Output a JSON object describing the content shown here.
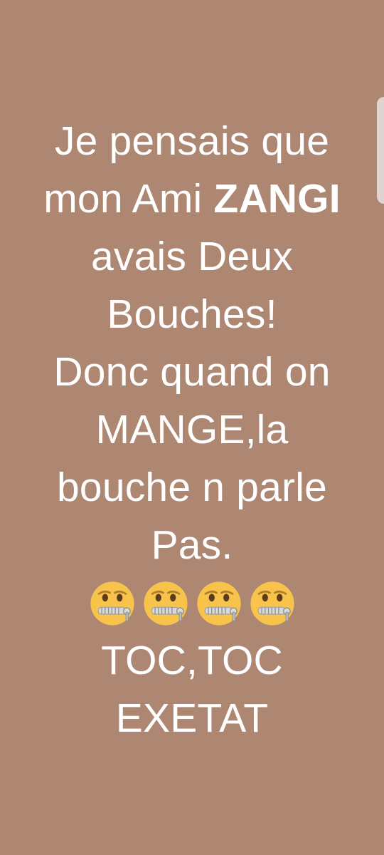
{
  "post": {
    "line1": "Je pensais que",
    "line2_prefix": "mon Ami ",
    "line2_bold": "ZANGI",
    "line3": "avais Deux",
    "line4": "Bouches!",
    "line5": "Donc quand on",
    "line6": "MANGE,la",
    "line7": "bouche n parle",
    "line8": "Pas.",
    "line9": "TOC,TOC",
    "line10": "EXETAT",
    "emoji_icon": "zipper-mouth-face-icon",
    "emoji_count": 4
  },
  "colors": {
    "background": "#AE8773",
    "text": "#FFFFFF",
    "emoji_face": "#F7C34B",
    "emoji_zipper": "#BDBDBD"
  }
}
